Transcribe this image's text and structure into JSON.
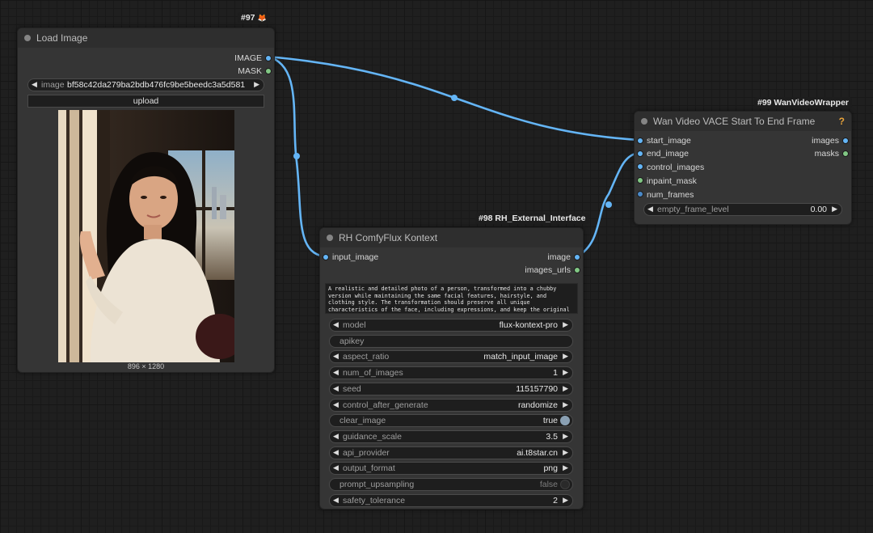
{
  "nodes": {
    "load_image": {
      "badge": "#97",
      "badge_icon": "🦊",
      "title": "Load Image",
      "outputs": [
        "IMAGE",
        "MASK"
      ],
      "image_widget": {
        "label": "image",
        "value": "bf58c42da279ba2bdb476fc9be5beedc3a5d581..."
      },
      "upload_label": "upload",
      "image_size": "896 × 1280"
    },
    "flux_kontext": {
      "badge": "#98 RH_External_Interface",
      "title": "RH ComfyFlux Kontext",
      "inputs": [
        "input_image"
      ],
      "outputs": [
        "image",
        "images_urls"
      ],
      "prompt": "A realistic and detailed photo of a person, transformed into a chubby version while maintaining the same facial features, hairstyle, and clothing style. The transformation should preserve all unique characteristics of the face, including expressions, and keep the original",
      "widgets": [
        {
          "label": "model",
          "value": "flux-kontext-pro",
          "kind": "combo"
        },
        {
          "label": "apikey",
          "value": "",
          "kind": "text"
        },
        {
          "label": "aspect_ratio",
          "value": "match_input_image",
          "kind": "combo"
        },
        {
          "label": "num_of_images",
          "value": "1",
          "kind": "combo"
        },
        {
          "label": "seed",
          "value": "115157790",
          "kind": "combo"
        },
        {
          "label": "control_after_generate",
          "value": "randomize",
          "kind": "combo"
        },
        {
          "label": "clear_image",
          "value": "true",
          "kind": "toggle_on"
        },
        {
          "label": "guidance_scale",
          "value": "3.5",
          "kind": "combo"
        },
        {
          "label": "api_provider",
          "value": "ai.t8star.cn",
          "kind": "combo"
        },
        {
          "label": "output_format",
          "value": "png",
          "kind": "combo"
        },
        {
          "label": "prompt_upsampling",
          "value": "false",
          "kind": "toggle_off"
        },
        {
          "label": "safety_tolerance",
          "value": "2",
          "kind": "combo"
        }
      ]
    },
    "wan_vace": {
      "badge": "#99 WanVideoWrapper",
      "title": "Wan Video VACE Start To End Frame",
      "help_icon": "?",
      "inputs": [
        "start_image",
        "end_image",
        "control_images",
        "inpaint_mask",
        "num_frames"
      ],
      "outputs": [
        "images",
        "masks"
      ],
      "widget": {
        "label": "empty_frame_level",
        "value": "0.00"
      }
    }
  },
  "colors": {
    "wire": "#64b5f6",
    "image_port": "#64b5f6",
    "mask_port": "#81c784",
    "int_port": "#4a89c8",
    "badge_icon": "#ff8a3d",
    "help_icon": "#e8a33a"
  },
  "icons": [
    "fox-icon",
    "help-icon",
    "arrow-left-icon",
    "arrow-right-icon",
    "toggle-icon"
  ]
}
